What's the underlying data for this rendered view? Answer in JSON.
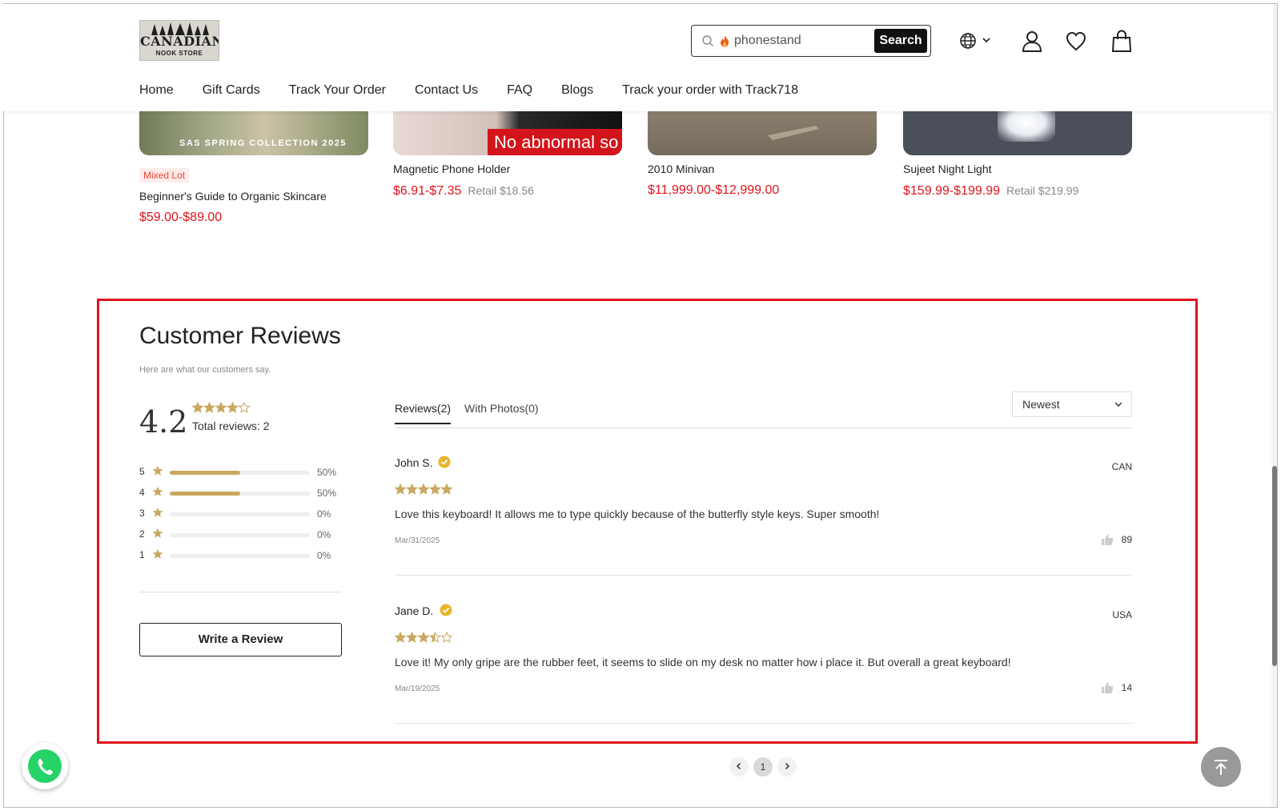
{
  "header": {
    "logo": {
      "name": "CANADIAN",
      "sub": "NOOK STORE"
    },
    "search": {
      "value": "phonestand",
      "button": "Search"
    },
    "nav": [
      "Home",
      "Gift Cards",
      "Track Your Order",
      "Contact Us",
      "FAQ",
      "Blogs",
      "Track your order with Track718"
    ]
  },
  "products": [
    {
      "overlay": "SAS  SPRING COLLECTION 2025",
      "badge": "Mixed Lot",
      "title": "Beginner's Guide to Organic Skincare",
      "price": "$59.00-$89.00",
      "retail": ""
    },
    {
      "overlay": "No abnormal so",
      "title": "Magnetic Phone Holder",
      "price": "$6.91-$7.35",
      "retail": "Retail $18.56"
    },
    {
      "title": "2010 Minivan",
      "price": "$11,999.00-$12,999.00",
      "retail": ""
    },
    {
      "title": "Sujeet Night Light",
      "price": "$159.99-$199.99",
      "retail": "Retail $219.99"
    }
  ],
  "reviews": {
    "title": "Customer Reviews",
    "subtitle": "Here are what our customers say.",
    "average": "4.2",
    "average_value": 4.2,
    "total": "Total reviews: 2",
    "distribution": [
      {
        "star": "5",
        "pct": "50%",
        "fraction": 0.5
      },
      {
        "star": "4",
        "pct": "50%",
        "fraction": 0.5
      },
      {
        "star": "3",
        "pct": "0%",
        "fraction": 0
      },
      {
        "star": "2",
        "pct": "0%",
        "fraction": 0
      },
      {
        "star": "1",
        "pct": "0%",
        "fraction": 0
      }
    ],
    "write_button": "Write a Review",
    "tabs": [
      "Reviews(2)",
      "With Photos(0)"
    ],
    "sort": "Newest",
    "items": [
      {
        "name": "John S.",
        "country": "CAN",
        "rating": 5,
        "text": "Love this keyboard! It allows me to type quickly because of the butterfly style keys. Super smooth!",
        "date": "Mar/31/2025",
        "likes": "89"
      },
      {
        "name": "Jane D.",
        "country": "USA",
        "rating": 3.5,
        "text": "Love it! My only gripe are the rubber feet, it seems to slide on my desk no matter how i place it. But overall a great keyboard!",
        "date": "Mar/19/2025",
        "likes": "14"
      }
    ]
  },
  "pagination": {
    "current": "1"
  },
  "colors": {
    "star": "#c9a85f",
    "price": "#e0141b",
    "highlight": "#e0141b",
    "verified": "#e8b52a"
  }
}
